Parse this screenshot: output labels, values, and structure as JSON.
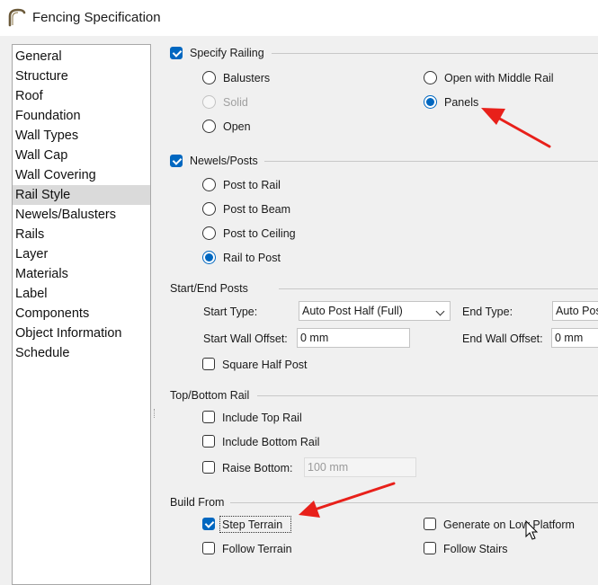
{
  "window": {
    "title": "Fencing Specification",
    "icon": "arch-icon"
  },
  "sidebar": {
    "items": [
      {
        "label": "General"
      },
      {
        "label": "Structure"
      },
      {
        "label": "Roof"
      },
      {
        "label": "Foundation"
      },
      {
        "label": "Wall Types"
      },
      {
        "label": "Wall Cap"
      },
      {
        "label": "Wall Covering"
      },
      {
        "label": "Rail Style",
        "selected": true
      },
      {
        "label": "Newels/Balusters"
      },
      {
        "label": "Rails"
      },
      {
        "label": "Layer"
      },
      {
        "label": "Materials"
      },
      {
        "label": "Label"
      },
      {
        "label": "Components"
      },
      {
        "label": "Object Information"
      },
      {
        "label": "Schedule"
      }
    ]
  },
  "railing": {
    "label": "Specify Railing",
    "checked": true,
    "options": {
      "balusters": {
        "label": "Balusters",
        "selected": false
      },
      "solid": {
        "label": "Solid",
        "selected": false,
        "disabled": true
      },
      "open": {
        "label": "Open",
        "selected": false
      },
      "open_middle_rail": {
        "label": "Open with Middle Rail",
        "selected": false
      },
      "panels": {
        "label": "Panels",
        "selected": true
      }
    }
  },
  "newels": {
    "label": "Newels/Posts",
    "checked": true,
    "options": {
      "post_to_rail": {
        "label": "Post to Rail",
        "selected": false
      },
      "post_to_beam": {
        "label": "Post to Beam",
        "selected": false
      },
      "post_to_ceiling": {
        "label": "Post to Ceiling",
        "selected": false
      },
      "rail_to_post": {
        "label": "Rail to Post",
        "selected": true
      }
    }
  },
  "start_end_posts": {
    "title": "Start/End Posts",
    "start_type_label": "Start Type:",
    "start_type_value": "Auto Post Half (Full)",
    "end_type_label": "End Type:",
    "end_type_value": "Auto Pos",
    "start_offset_label": "Start Wall Offset:",
    "start_offset_value": "0 mm",
    "end_offset_label": "End Wall Offset:",
    "end_offset_value": "0 mm",
    "square_half_post": {
      "label": "Square Half Post",
      "checked": false
    }
  },
  "top_bottom_rail": {
    "title": "Top/Bottom Rail",
    "include_top": {
      "label": "Include Top Rail",
      "checked": false
    },
    "include_bottom": {
      "label": "Include Bottom Rail",
      "checked": false
    },
    "raise_bottom": {
      "label": "Raise Bottom:",
      "checked": false
    },
    "raise_bottom_value": "100 mm"
  },
  "build_from": {
    "title": "Build From",
    "step_terrain": {
      "label": "Step Terrain",
      "checked": true
    },
    "follow_terrain": {
      "label": "Follow Terrain",
      "checked": false
    },
    "low_platform": {
      "label": "Generate on Low Platform",
      "checked": false
    },
    "follow_stairs": {
      "label": "Follow Stairs",
      "checked": false
    }
  },
  "colors": {
    "accent": "#0067c0",
    "annotation_arrow": "#e8201a",
    "selection": "#dadada"
  }
}
